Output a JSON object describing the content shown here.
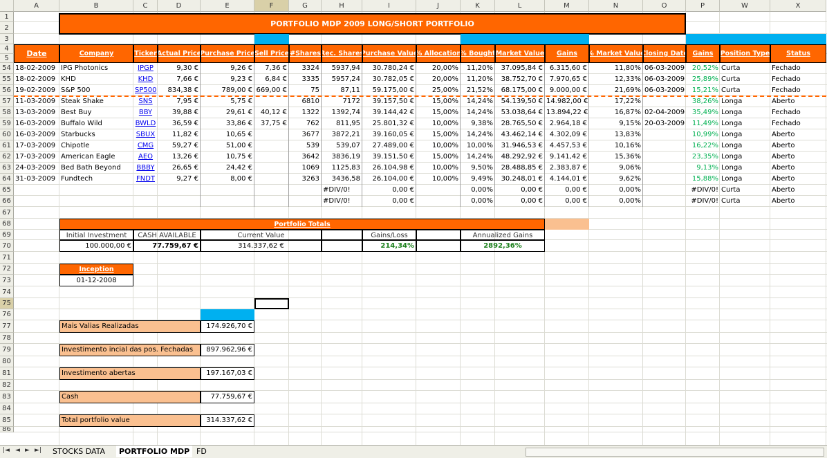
{
  "columns": [
    {
      "letter": "A",
      "w": 66
    },
    {
      "letter": "B",
      "w": 107
    },
    {
      "letter": "C",
      "w": 35
    },
    {
      "letter": "D",
      "w": 62
    },
    {
      "letter": "E",
      "w": 78
    },
    {
      "letter": "F",
      "w": 50
    },
    {
      "letter": "G",
      "w": 47
    },
    {
      "letter": "H",
      "w": 59
    },
    {
      "letter": "I",
      "w": 78
    },
    {
      "letter": "J",
      "w": 64
    },
    {
      "letter": "K",
      "w": 50
    },
    {
      "letter": "L",
      "w": 72
    },
    {
      "letter": "M",
      "w": 64
    },
    {
      "letter": "N",
      "w": 78
    },
    {
      "letter": "O",
      "w": 62
    },
    {
      "letter": "P",
      "w": 49
    },
    {
      "letter": "W",
      "w": 73
    },
    {
      "letter": "X",
      "w": 81
    }
  ],
  "selected_column": "F",
  "selected_row": "75",
  "title": "PORTFOLIO MDP 2009 LONG/SHORT PORTFOLIO",
  "headers": [
    "Date",
    "Company",
    "Ticker",
    "Actual Price",
    "Purchase Price",
    "Sell Price",
    "#Shares",
    "Rec. Shares",
    "Purchase Value",
    "% Allocation",
    "% Bought",
    "Market Value",
    "Gains",
    "% Market Value",
    "Closing Date",
    "Gains",
    "Position Type",
    "Status"
  ],
  "rows": [
    {
      "n": "54",
      "cells": [
        "18-02-2009",
        "IPG Photonics",
        "IPGP",
        "9,30 €",
        "9,26 €",
        "7,36 €",
        "3324",
        "5937,94",
        "30.780,24 €",
        "20,00%",
        "11,20%",
        "37.095,84 €",
        "6.315,60 €",
        "11,80%",
        "06-03-2009",
        "20,52%",
        "Curta",
        "Fechado"
      ]
    },
    {
      "n": "55",
      "cells": [
        "18-02-2009",
        "KHD",
        "KHD",
        "7,66 €",
        "9,23 €",
        "6,84 €",
        "3335",
        "5957,24",
        "30.782,05 €",
        "20,00%",
        "11,20%",
        "38.752,70 €",
        "7.970,65 €",
        "12,33%",
        "06-03-2009",
        "25,89%",
        "Curta",
        "Fechado"
      ]
    },
    {
      "n": "56",
      "cells": [
        "19-02-2009",
        "S&P 500",
        "SP500",
        "834,38 €",
        "789,00 €",
        "669,00 €",
        "75",
        "87,11",
        "59.175,00 €",
        "25,00%",
        "21,52%",
        "68.175,00 €",
        "9.000,00 €",
        "21,69%",
        "06-03-2009",
        "15,21%",
        "Curta",
        "Fechado"
      ]
    },
    {
      "n": "57",
      "cells": [
        "11-03-2009",
        "Steak Shake",
        "SNS",
        "7,95 €",
        "5,75 €",
        "",
        "6810",
        "7172",
        "39.157,50 €",
        "15,00%",
        "14,24%",
        "54.139,50 €",
        "14.982,00 €",
        "17,22%",
        "",
        "38,26%",
        "Longa",
        "Aberto"
      ]
    },
    {
      "n": "58",
      "cells": [
        "13-03-2009",
        "Best Buy",
        "BBY",
        "39,88 €",
        "29,61 €",
        "40,12 €",
        "1322",
        "1392,74",
        "39.144,42 €",
        "15,00%",
        "14,24%",
        "53.038,64 €",
        "13.894,22 €",
        "16,87%",
        "02-04-2009",
        "35,49%",
        "Longa",
        "Fechado"
      ]
    },
    {
      "n": "59",
      "cells": [
        "16-03-2009",
        "Buffalo Wild",
        "BWLD",
        "36,59 €",
        "33,86 €",
        "37,75 €",
        "762",
        "811,95",
        "25.801,32 €",
        "10,00%",
        "9,38%",
        "28.765,50 €",
        "2.964,18 €",
        "9,15%",
        "20-03-2009",
        "11,49%",
        "Longa",
        "Fechado"
      ]
    },
    {
      "n": "60",
      "cells": [
        "16-03-2009",
        "Starbucks",
        "SBUX",
        "11,82 €",
        "10,65 €",
        "",
        "3677",
        "3872,21",
        "39.160,05 €",
        "15,00%",
        "14,24%",
        "43.462,14 €",
        "4.302,09 €",
        "13,83%",
        "",
        "10,99%",
        "Longa",
        "Aberto"
      ]
    },
    {
      "n": "61",
      "cells": [
        "17-03-2009",
        "Chipotle",
        "CMG",
        "59,27 €",
        "51,00 €",
        "",
        "539",
        "539,07",
        "27.489,00 €",
        "10,00%",
        "10,00%",
        "31.946,53 €",
        "4.457,53 €",
        "10,16%",
        "",
        "16,22%",
        "Longa",
        "Aberto"
      ]
    },
    {
      "n": "62",
      "cells": [
        "17-03-2009",
        "American Eagle",
        "AEO",
        "13,26 €",
        "10,75 €",
        "",
        "3642",
        "3836,19",
        "39.151,50 €",
        "15,00%",
        "14,24%",
        "48.292,92 €",
        "9.141,42 €",
        "15,36%",
        "",
        "23,35%",
        "Longa",
        "Aberto"
      ]
    },
    {
      "n": "63",
      "cells": [
        "24-03-2009",
        "Bed Bath Beyond",
        "BBBY",
        "26,65 €",
        "24,42 €",
        "",
        "1069",
        "1125,83",
        "26.104,98 €",
        "10,00%",
        "9,50%",
        "28.488,85 €",
        "2.383,87 €",
        "9,06%",
        "",
        "9,13%",
        "Longa",
        "Aberto"
      ]
    },
    {
      "n": "64",
      "cells": [
        "31-03-2009",
        "Fundtech",
        "FNDT",
        "9,27 €",
        "8,00 €",
        "",
        "3263",
        "3436,58",
        "26.104,00 €",
        "10,00%",
        "9,49%",
        "30.248,01 €",
        "4.144,01 €",
        "9,62%",
        "",
        "15,88%",
        "Longa",
        "Aberto"
      ]
    },
    {
      "n": "65",
      "cells": [
        "",
        "",
        "",
        "",
        "",
        "",
        "",
        "#DIV/0!",
        "0,00 €",
        "",
        "0,00%",
        "0,00 €",
        "0,00 €",
        "0,00%",
        "",
        "#DIV/0!",
        "Curta",
        "Aberto"
      ]
    },
    {
      "n": "66",
      "cells": [
        "",
        "",
        "",
        "",
        "",
        "",
        "",
        "#DIV/0!",
        "0,00 €",
        "",
        "0,00%",
        "0,00 €",
        "0,00 €",
        "0,00%",
        "",
        "#DIV/0!",
        "Curta",
        "Aberto"
      ]
    }
  ],
  "totals": {
    "title": "Portfolio Totals",
    "labels": [
      "Initial Investment",
      "CASH AVAILABLE",
      "Current Value",
      "",
      "Gains/Loss",
      "",
      "Annualized Gains"
    ],
    "values": [
      "100.000,00 €",
      "77.759,67 €",
      "314.337,62 €",
      "",
      "214,34%",
      "",
      "2892,36%"
    ]
  },
  "inception": {
    "label": "Inception",
    "value": "01-12-2008"
  },
  "summary": [
    {
      "label": "Mais Valias Realizadas",
      "value": "174.926,70 €"
    },
    {
      "label": "Investimento incial das pos. Fechadas",
      "value": "897.962,96 €"
    },
    {
      "label": "Investimento abertas",
      "value": "197.167,03 €"
    },
    {
      "label": "Cash",
      "value": "77.759,67 €"
    },
    {
      "label": "Total portfolio value",
      "value": "314.337,62 €"
    }
  ],
  "tabs": [
    "STOCKS DATA",
    "PORTFOLIO MDP",
    "FD"
  ],
  "active_tab": "PORTFOLIO MDP"
}
